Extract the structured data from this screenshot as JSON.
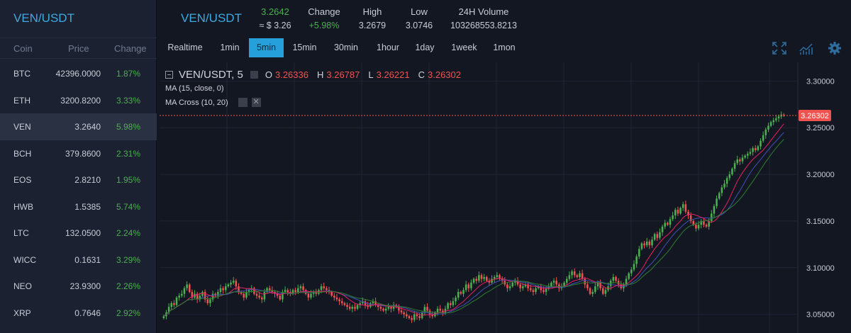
{
  "sidebar": {
    "title": "VEN/USDT",
    "headers": {
      "coin": "Coin",
      "price": "Price",
      "change": "Change"
    },
    "coins": [
      {
        "symbol": "BTC",
        "price": "42396.0000",
        "change": "1.87%"
      },
      {
        "symbol": "ETH",
        "price": "3200.8200",
        "change": "3.33%"
      },
      {
        "symbol": "VEN",
        "price": "3.2640",
        "change": "5.98%"
      },
      {
        "symbol": "BCH",
        "price": "379.8600",
        "change": "2.31%"
      },
      {
        "symbol": "EOS",
        "price": "2.8210",
        "change": "1.95%"
      },
      {
        "symbol": "HWB",
        "price": "1.5385",
        "change": "5.74%"
      },
      {
        "symbol": "LTC",
        "price": "132.0500",
        "change": "2.24%"
      },
      {
        "symbol": "WICC",
        "price": "0.1631",
        "change": "3.29%"
      },
      {
        "symbol": "NEO",
        "price": "23.9300",
        "change": "2.26%"
      },
      {
        "symbol": "XRP",
        "price": "0.7646",
        "change": "2.92%"
      }
    ],
    "active_symbol": "VEN"
  },
  "header": {
    "pair": "VEN/USDT",
    "last_price": "3.2642",
    "last_price_usd": "≈ $ 3.26",
    "change_label": "Change",
    "change_value": "+5.98%",
    "high_label": "High",
    "high_value": "3.2679",
    "low_label": "Low",
    "low_value": "3.0746",
    "volume_label": "24H Volume",
    "volume_value": "103268553.8213"
  },
  "toolbar": {
    "timeframes": [
      "Realtime",
      "1min",
      "5min",
      "15min",
      "30min",
      "1hour",
      "1day",
      "1week",
      "1mon"
    ],
    "active_timeframe": "5min",
    "icons": [
      "fullscreen-icon",
      "indicators-icon",
      "settings-icon"
    ]
  },
  "chart_legend": {
    "symbol": "VEN/USDT, 5",
    "open_label": "O",
    "open": "3.26336",
    "high_label": "H",
    "high": "3.26787",
    "low_label": "L",
    "low": "3.26221",
    "close_label": "C",
    "close": "3.26302",
    "ma_label": "MA (15, close, 0)",
    "ma_cross_label": "MA Cross (10, 20)"
  },
  "chart_data": {
    "type": "candlestick",
    "y_ticks": [
      "3.30000",
      "3.25000",
      "3.20000",
      "3.15000",
      "3.10000",
      "3.05000"
    ],
    "ylim": [
      3.03,
      3.32
    ],
    "last_price_label": "3.26302",
    "last_price": 3.26302,
    "grid": true,
    "colors": {
      "up": "#26a69a",
      "up_bright": "#4caf50",
      "down": "#ef5350",
      "ma": "#3f51b5",
      "ma_fast": "#e91e63",
      "ma_slow": "#2e7d32",
      "last": "#ef5350"
    },
    "closes": [
      3.048,
      3.052,
      3.058,
      3.062,
      3.06,
      3.068,
      3.07,
      3.072,
      3.078,
      3.082,
      3.074,
      3.068,
      3.072,
      3.066,
      3.07,
      3.074,
      3.066,
      3.062,
      3.066,
      3.072,
      3.07,
      3.074,
      3.078,
      3.076,
      3.08,
      3.082,
      3.084,
      3.086,
      3.08,
      3.074,
      3.072,
      3.068,
      3.074,
      3.076,
      3.078,
      3.072,
      3.07,
      3.068,
      3.066,
      3.074,
      3.078,
      3.076,
      3.074,
      3.072,
      3.07,
      3.066,
      3.074,
      3.076,
      3.074,
      3.072,
      3.076,
      3.074,
      3.078,
      3.08,
      3.076,
      3.072,
      3.068,
      3.072,
      3.074,
      3.072,
      3.076,
      3.08,
      3.078,
      3.076,
      3.074,
      3.07,
      3.068,
      3.066,
      3.064,
      3.062,
      3.06,
      3.058,
      3.056,
      3.058,
      3.056,
      3.06,
      3.062,
      3.064,
      3.06,
      3.058,
      3.062,
      3.064,
      3.06,
      3.058,
      3.056,
      3.054,
      3.056,
      3.058,
      3.056,
      3.06,
      3.058,
      3.054,
      3.052,
      3.05,
      3.048,
      3.046,
      3.044,
      3.05,
      3.048,
      3.046,
      3.052,
      3.058,
      3.054,
      3.05,
      3.048,
      3.052,
      3.056,
      3.054,
      3.052,
      3.056,
      3.062,
      3.06,
      3.064,
      3.068,
      3.074,
      3.072,
      3.076,
      3.082,
      3.078,
      3.084,
      3.088,
      3.086,
      3.092,
      3.088,
      3.09,
      3.086,
      3.084,
      3.088,
      3.09,
      3.092,
      3.088,
      3.086,
      3.082,
      3.078,
      3.08,
      3.084,
      3.086,
      3.082,
      3.078,
      3.08,
      3.082,
      3.078,
      3.076,
      3.074,
      3.078,
      3.08,
      3.076,
      3.074,
      3.078,
      3.08,
      3.084,
      3.086,
      3.082,
      3.078,
      3.08,
      3.084,
      3.088,
      3.092,
      3.096,
      3.092,
      3.09,
      3.094,
      3.088,
      3.082,
      3.078,
      3.072,
      3.074,
      3.08,
      3.084,
      3.078,
      3.072,
      3.076,
      3.08,
      3.086,
      3.09,
      3.086,
      3.082,
      3.078,
      3.082,
      3.088,
      3.094,
      3.098,
      3.104,
      3.112,
      3.12,
      3.126,
      3.124,
      3.128,
      3.124,
      3.13,
      3.136,
      3.132,
      3.138,
      3.144,
      3.148,
      3.146,
      3.152,
      3.156,
      3.162,
      3.158,
      3.164,
      3.168,
      3.16,
      3.156,
      3.15,
      3.146,
      3.142,
      3.146,
      3.15,
      3.146,
      3.144,
      3.15,
      3.158,
      3.166,
      3.174,
      3.18,
      3.186,
      3.19,
      3.196,
      3.2,
      3.206,
      3.212,
      3.216,
      3.214,
      3.218,
      3.22,
      3.222,
      3.224,
      3.228,
      3.226,
      3.23,
      3.236,
      3.242,
      3.248,
      3.252,
      3.256,
      3.258,
      3.26,
      3.262,
      3.264,
      3.263
    ]
  }
}
